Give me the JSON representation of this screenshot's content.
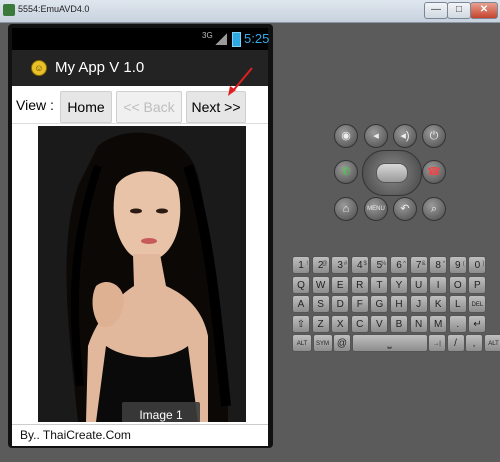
{
  "window": {
    "title": "5554:EmuAVD4.0",
    "min_label": "—",
    "max_label": "□",
    "close_label": "✕"
  },
  "statusbar": {
    "network": "3G",
    "time": "5:25"
  },
  "app": {
    "title": "My App V 1.0",
    "icon": "app-icon"
  },
  "controls": {
    "view_label": "View :",
    "home_label": "Home",
    "back_label": "<< Back",
    "next_label": "Next >>"
  },
  "image_viewer": {
    "toast_text": "Image 1"
  },
  "footer": {
    "text": "By.. ThaiCreate.Com"
  },
  "emulator_buttons": {
    "row1": [
      "camera-icon",
      "volume-down-icon",
      "volume-up-icon",
      "power-icon"
    ],
    "row2": [
      "call-icon",
      "dpad",
      "end-call-icon"
    ],
    "row3": [
      "home-icon",
      "MENU",
      "back-icon",
      "search-icon"
    ],
    "menu_label": "MENU"
  },
  "keyboard": {
    "rows": [
      [
        "1",
        "2",
        "3",
        "4",
        "5",
        "6",
        "7",
        "8",
        "9",
        "0"
      ],
      [
        "Q",
        "W",
        "E",
        "R",
        "T",
        "Y",
        "U",
        "I",
        "O",
        "P"
      ],
      [
        "A",
        "S",
        "D",
        "F",
        "G",
        "H",
        "J",
        "K",
        "L",
        "DEL"
      ],
      [
        "⇧",
        "Z",
        "X",
        "C",
        "V",
        "B",
        "N",
        "M",
        ".",
        "↵"
      ],
      [
        "ALT",
        "SYM",
        "@",
        "⎵",
        "→|",
        "/",
        ",",
        "ALT"
      ]
    ],
    "secondary": [
      [
        "!",
        "@",
        "#",
        "$",
        "%",
        "^",
        "&",
        "*",
        "(",
        ")"
      ]
    ]
  },
  "colors": {
    "time": "#39a9e6",
    "actionbar": "#232323",
    "emulator_bg": "#5b5b5b",
    "arrow": "#e02020"
  }
}
